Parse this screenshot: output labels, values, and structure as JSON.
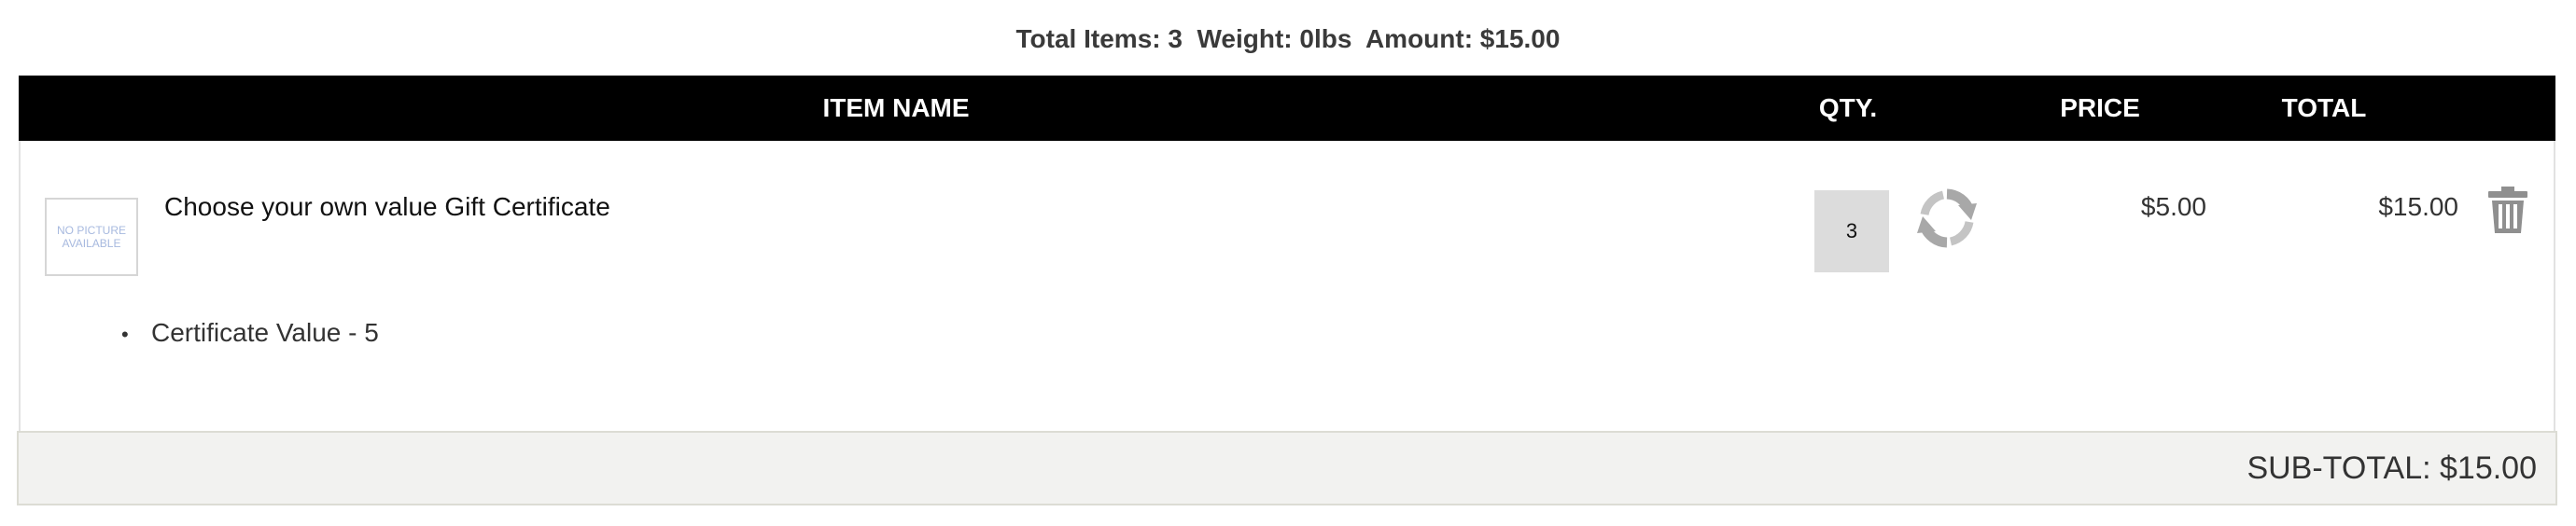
{
  "summary": {
    "text": "Total Items: 3  Weight: 0lbs  Amount: $15.00"
  },
  "table_header": {
    "item_name": "ITEM NAME",
    "qty": "QTY.",
    "price": "PRICE",
    "total": "TOTAL"
  },
  "items": [
    {
      "thumbnail_text": "NO PICTURE AVAILABLE",
      "name": "Choose your own value Gift Certificate",
      "options": [
        "Certificate Value - 5"
      ],
      "qty": "3",
      "price": "$5.00",
      "total": "$15.00",
      "refresh_icon": "refresh-icon",
      "delete_icon": "trash-icon"
    }
  ],
  "subtotal": {
    "text": "SUB-TOTAL: $15.00"
  },
  "colors": {
    "header_bg": "#000000",
    "header_text": "#ffffff",
    "qty_bg": "#dcdcdc",
    "subtotal_bg": "#f2f2f0",
    "icon_gray": "#9a9a9a"
  }
}
